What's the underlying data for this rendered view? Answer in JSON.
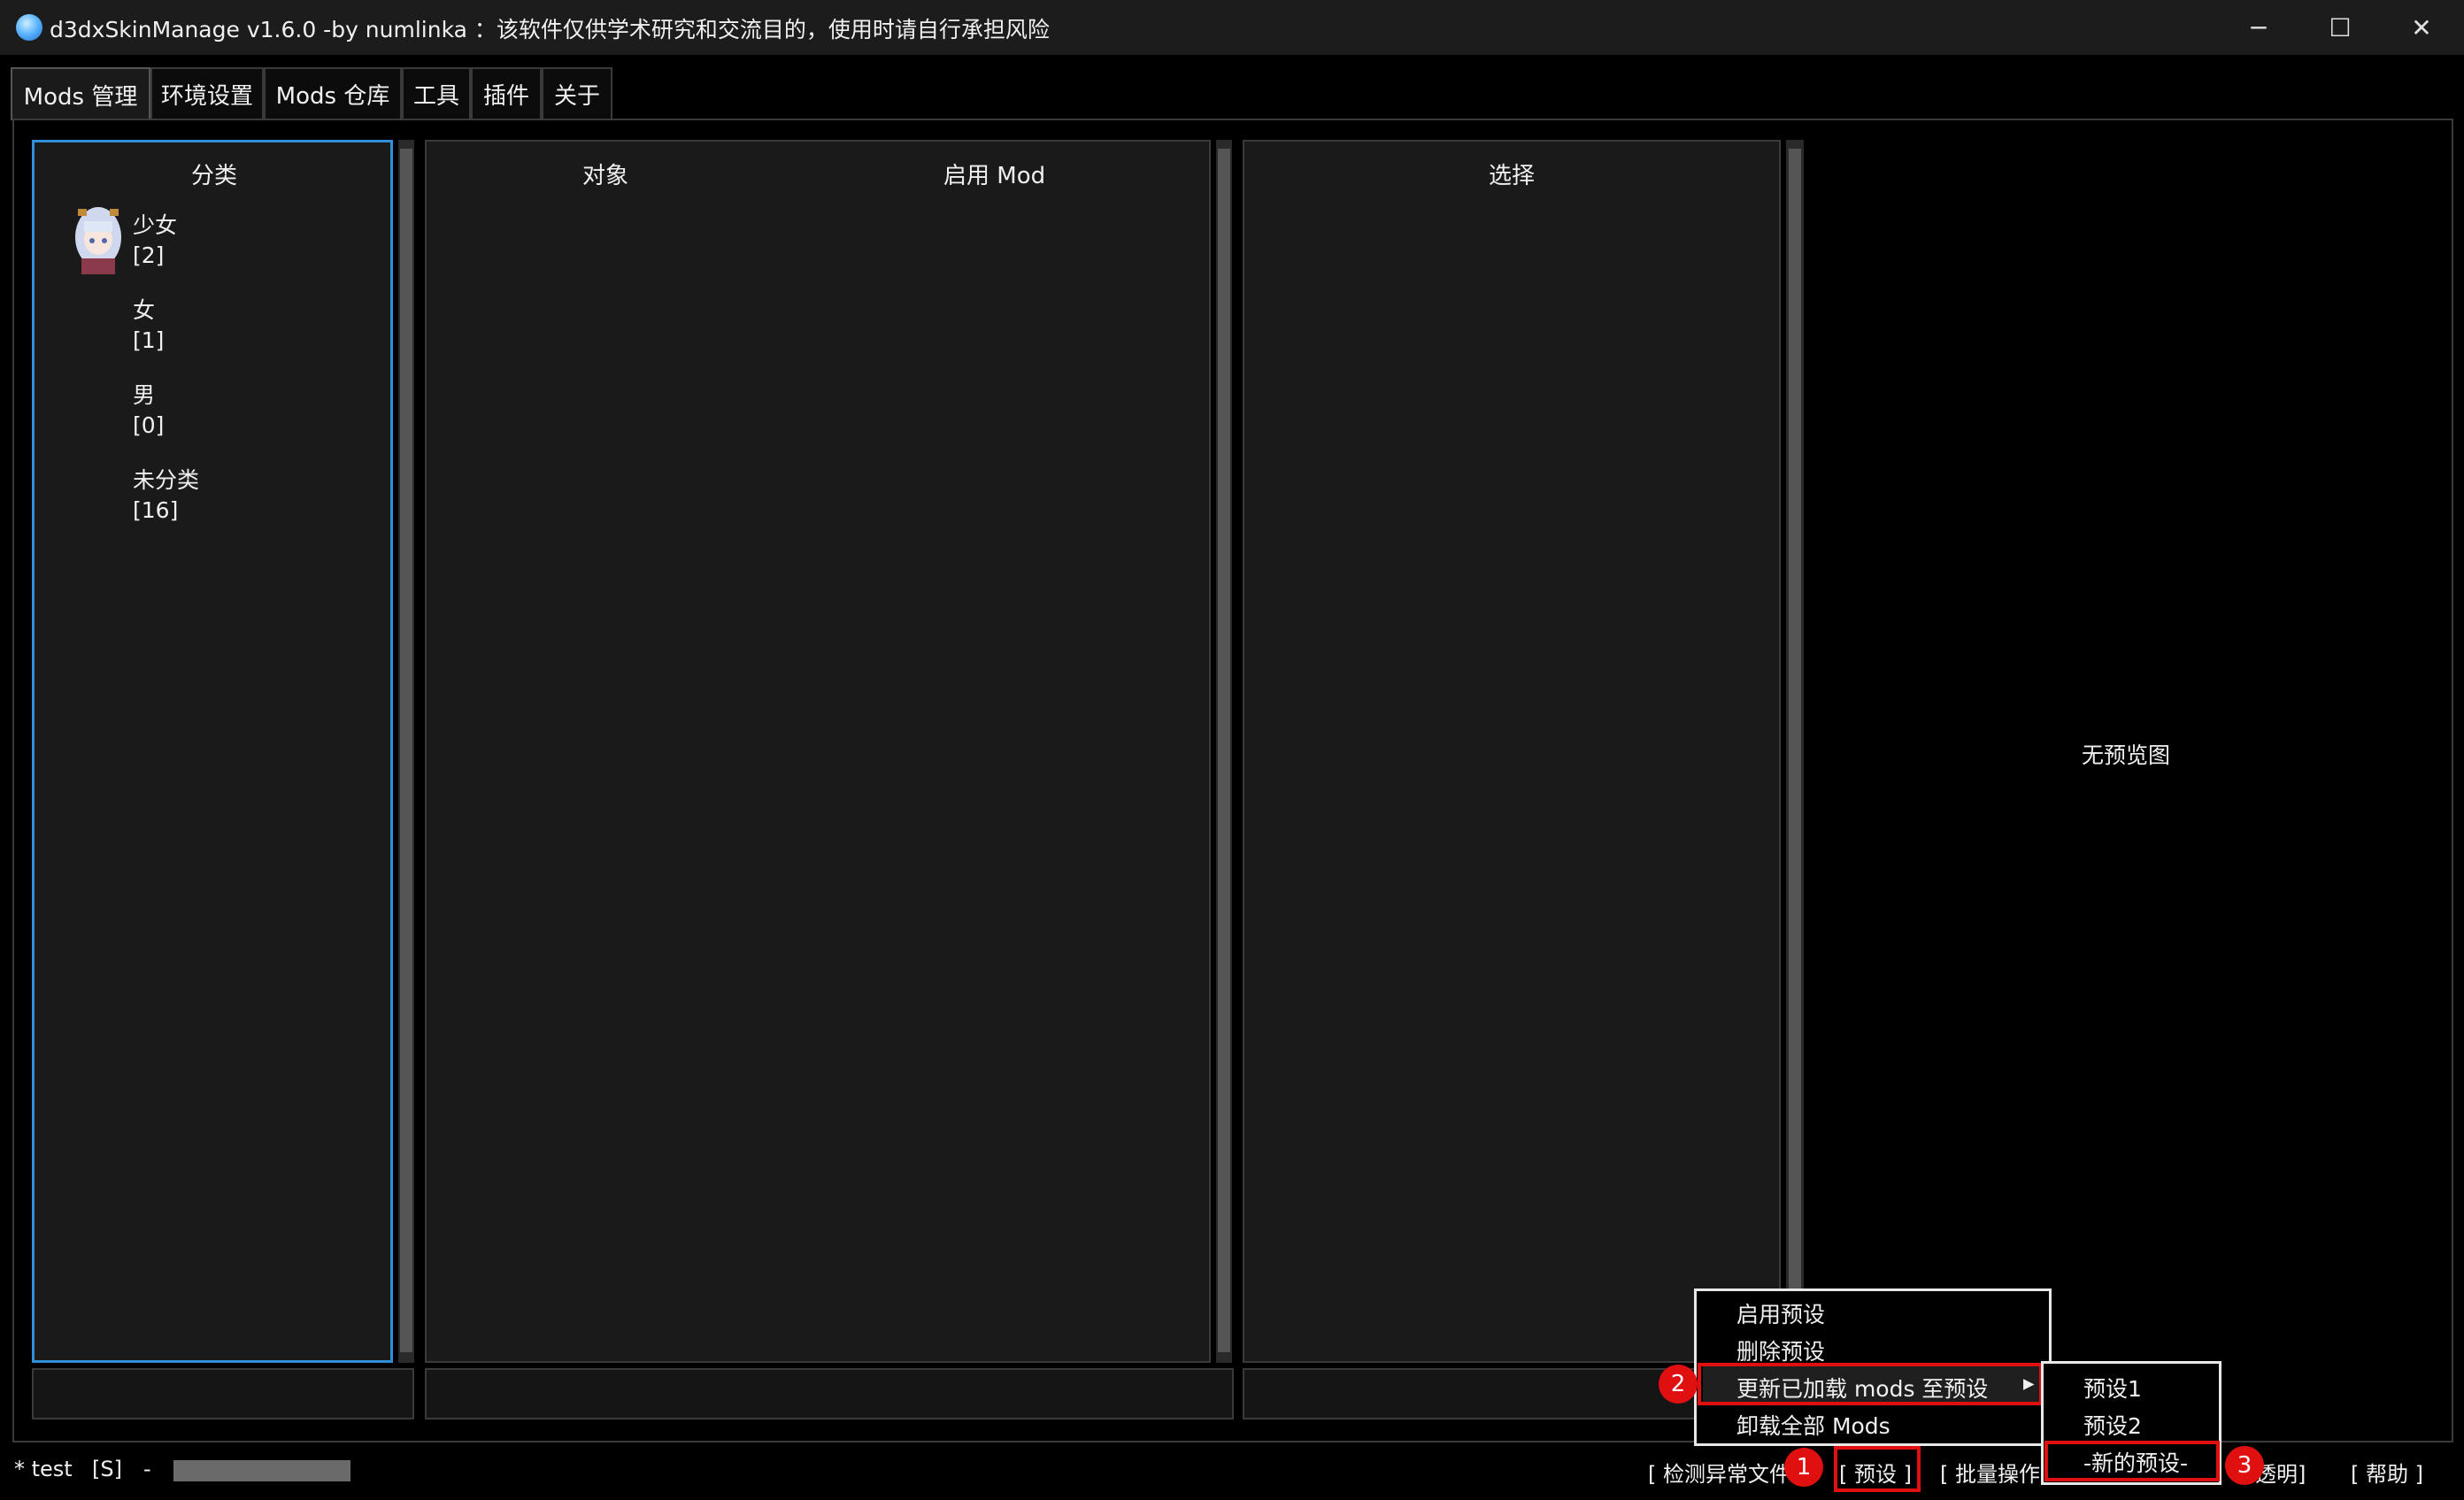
{
  "window": {
    "title": "d3dxSkinManage v1.6.0 -by numlinka ：该软件仅供学术研究和交流目的，使用时请自行承担风险",
    "icon": "app-logo-icon",
    "minimize_glyph": "─",
    "maximize_glyph": "☐",
    "close_glyph": "✕"
  },
  "tabs": [
    {
      "label": "Mods 管理",
      "active": true
    },
    {
      "label": "环境设置"
    },
    {
      "label": "Mods 仓库"
    },
    {
      "label": "工具"
    },
    {
      "label": "插件"
    },
    {
      "label": "关于"
    }
  ],
  "category_panel": {
    "header": "分类",
    "items": [
      {
        "name": "少女",
        "count": "[2]",
        "has_avatar": true
      },
      {
        "name": "女",
        "count": "[1]"
      },
      {
        "name": "男",
        "count": "[0]"
      },
      {
        "name": "未分类",
        "count": "[16]"
      }
    ]
  },
  "object_panel": {
    "header_object": "对象",
    "header_enabled": "启用 Mod"
  },
  "select_panel": {
    "header": "选择"
  },
  "preview": {
    "empty_text": "无预览图"
  },
  "status_bar": {
    "profile": "* test",
    "flag": "[S]",
    "dash": "-",
    "links": {
      "detect": "[ 检测异常文件",
      "preset": "[ 预设 ]",
      "batch": "[ 批量操作",
      "transparent": "口透明]",
      "help": "[ 帮助 ]"
    }
  },
  "context_menu": {
    "items": [
      "启用预设",
      "删除预设",
      "更新已加载 mods 至预设",
      "卸载全部 Mods"
    ],
    "submenu_arrow": "▸"
  },
  "submenu": {
    "items": [
      "预设1",
      "预设2",
      "-新的预设-"
    ]
  },
  "annotations": [
    "1",
    "2",
    "3"
  ],
  "colors": {
    "focus_border": "#2f8fd8",
    "annotation_red": "#e01010",
    "panel_bg": "#1a1a1a"
  }
}
